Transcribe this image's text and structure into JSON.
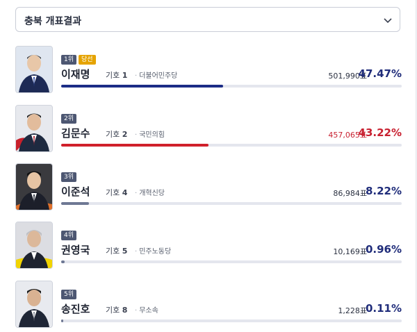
{
  "region_select": {
    "label": "충북 개표결과"
  },
  "colors": {
    "blue": "#1c2d86",
    "red": "#d0202b",
    "gray": "#6e7894"
  },
  "candidates": [
    {
      "rank": "1위",
      "elected": "당선",
      "name": "이재명",
      "num_label": "기호",
      "num": "1",
      "party": "더불어민주당",
      "votes": "501,990표",
      "pct": "47.47%",
      "share": 47.47
    },
    {
      "rank": "2위",
      "elected": "",
      "name": "김문수",
      "num_label": "기호",
      "num": "2",
      "party": "국민의힘",
      "votes": "457,065표",
      "pct": "43.22%",
      "share": 43.22
    },
    {
      "rank": "3위",
      "elected": "",
      "name": "이준석",
      "num_label": "기호",
      "num": "4",
      "party": "개혁신당",
      "votes": "86,984표",
      "pct": "8.22%",
      "share": 8.22
    },
    {
      "rank": "4위",
      "elected": "",
      "name": "권영국",
      "num_label": "기호",
      "num": "5",
      "party": "민주노동당",
      "votes": "10,169표",
      "pct": "0.96%",
      "share": 0.96
    },
    {
      "rank": "5위",
      "elected": "",
      "name": "송진호",
      "num_label": "기호",
      "num": "8",
      "party": "무소속",
      "votes": "1,228표",
      "pct": "0.11%",
      "share": 0.11
    }
  ]
}
